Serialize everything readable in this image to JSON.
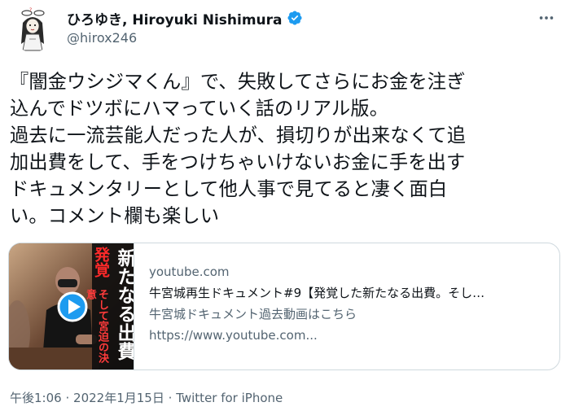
{
  "author": {
    "display_name": "ひろゆき, Hiroyuki Nishimura",
    "handle": "@hirox246",
    "avatar_icon": "avatar-illustration-icon",
    "verified_icon": "verified-badge-icon"
  },
  "more_icon": "more-options-icon",
  "tweet": {
    "lines": [
      "『闇金ウシジマくん』で、失敗してさらにお金を注ぎ",
      "込んでドツボにハマっていく話のリアル版。",
      "過去に一流芸能人だった人が、損切りが出来なくて追",
      "加出費をして、手をつけちゃいけないお金に手を出す",
      "ドキュメンタリーとして他人事で見てると凄く面白",
      "い。コメント欄も楽しい"
    ]
  },
  "card": {
    "domain": "youtube.com",
    "title": "牛宮城再生ドキュメント#9【発覚した新たなる出費。そし…",
    "description": "牛宮城ドキュメント過去動画はこちら",
    "url": "https://www.youtube.com...",
    "thumbnail": {
      "big_text_1": "発覚",
      "big_text_2": "新たなる出費",
      "sub_text": "そして宮迫の決意",
      "play_icon": "play-button-icon"
    }
  },
  "meta": {
    "time": "午後1:06",
    "separator": "·",
    "date": "2022年1月15日",
    "source": "Twitter for iPhone"
  },
  "colors": {
    "text": "#0f1419",
    "secondary": "#536471",
    "border": "#cfd9de",
    "verified": "#1d9bf0",
    "play": "#1d9bf0"
  }
}
